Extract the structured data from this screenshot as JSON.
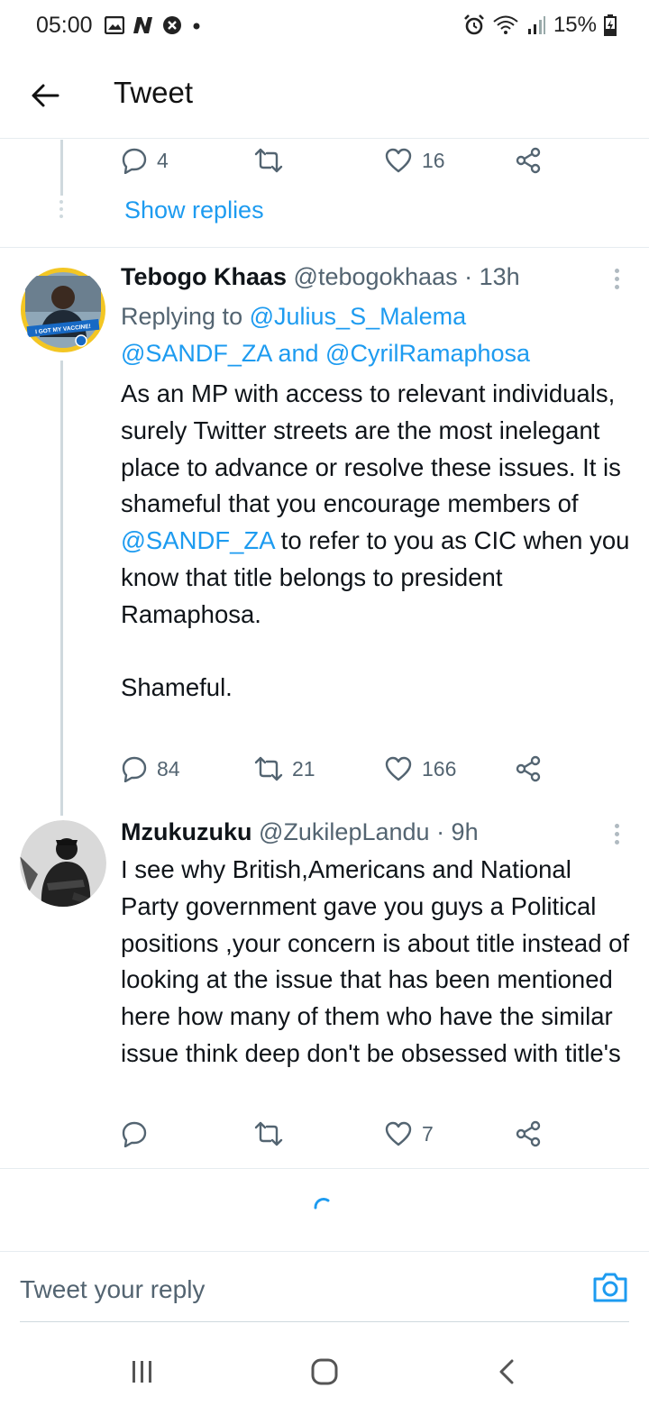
{
  "status_bar": {
    "time": "05:00",
    "left_icons": [
      "image-icon",
      "news-n-icon",
      "blocked-icon",
      "dot-icon"
    ],
    "right_icons": [
      "alarm-icon",
      "wifi-icon",
      "signal-icon",
      "battery-charging-icon"
    ],
    "battery": "15%"
  },
  "header": {
    "back_icon": "arrow-left-icon",
    "title": "Tweet"
  },
  "previous_tweet": {
    "replies": "4",
    "retweets": "",
    "likes": "16",
    "show_replies": "Show replies"
  },
  "tweets": [
    {
      "name": "Tebogo Khaas",
      "handle": "@tebogokhaas",
      "time": "· 13h",
      "replying_prefix": "Replying to",
      "replying_to_1": "@Julius_S_Malema",
      "replying_to_2": "@SANDF_ZA",
      "replying_and": "and",
      "replying_to_3": "@CyrilRamaphosa",
      "text_part1": "As an MP with access to relevant individuals, surely Twitter streets are the most inelegant place to advance or resolve these issues. It is shameful that you encourage members of ",
      "text_mention": "@SANDF_ZA",
      "text_part2": " to refer to you as CIC when you know that  title belongs to president Ramaphosa.",
      "text_part3": "Shameful.",
      "avatar_badge": "I GOT MY VACCINE!",
      "replies": "84",
      "retweets": "21",
      "likes": "166"
    },
    {
      "name": "Mzukuzuku",
      "handle": "@ZukilepLandu",
      "time": "· 9h",
      "text": "I see why British,Americans and National Party government gave you guys a Political positions ,your concern is about title instead of looking at the issue that has been mentioned here how many of them who have the similar issue think deep don't be obsessed with title's",
      "replies": "",
      "retweets": "",
      "likes": "7"
    }
  ],
  "reply_bar": {
    "placeholder": "Tweet your reply",
    "camera_icon": "camera-icon"
  },
  "nav_bar": {
    "icons": [
      "recent-apps-icon",
      "home-icon",
      "back-icon"
    ]
  },
  "colors": {
    "accent": "#1d9bf0",
    "secondary_text": "#536471",
    "divider": "#e6ecf0"
  }
}
